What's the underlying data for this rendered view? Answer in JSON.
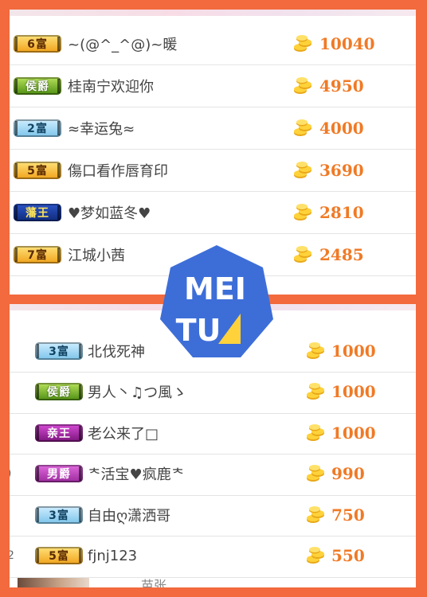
{
  "top_rows": [
    {
      "badge": "6富",
      "badge_style": "gold",
      "name": "~(@^_^@)~暖",
      "score": "10040"
    },
    {
      "badge": "侯爵",
      "badge_style": "green",
      "name": "桂南宁欢迎你",
      "score": "4950"
    },
    {
      "badge": "2富",
      "badge_style": "blue",
      "name": "≈幸运兔≈",
      "score": "4000"
    },
    {
      "badge": "5富",
      "badge_style": "gold",
      "name": "傷口看作唇育印",
      "score": "3690"
    },
    {
      "badge": "藩王",
      "badge_style": "navy",
      "name": "♥梦如蓝冬♥",
      "score": "2810"
    },
    {
      "badge": "7富",
      "badge_style": "gold",
      "name": "江城小茜",
      "score": "2485"
    }
  ],
  "bottom_rows": [
    {
      "badge": "3富",
      "badge_style": "blue",
      "name": "北伐死神",
      "score": "1000",
      "rank_fragment": ""
    },
    {
      "badge": "侯爵",
      "badge_style": "green",
      "name": "男人丶♫つ風ゝ",
      "score": "1000",
      "rank_fragment": ""
    },
    {
      "badge": "亲王",
      "badge_style": "purple",
      "name": "老公来了□",
      "score": "1000",
      "rank_fragment": ""
    },
    {
      "badge": "男爵",
      "badge_style": "magenta",
      "name": "ᅕ活宝♥疯鹿ᅕ",
      "score": "990",
      "rank_fragment": ")"
    },
    {
      "badge": "3富",
      "badge_style": "blue",
      "name": "自由ღ潇洒哥",
      "score": "750",
      "rank_fragment": ""
    },
    {
      "badge": "5富",
      "badge_style": "gold",
      "name": "fjnj123",
      "score": "550",
      "rank_fragment": "2"
    }
  ],
  "bottom_partial": {
    "name": "苗张"
  },
  "watermark": {
    "line1": "MEI",
    "line2": "TU"
  },
  "colors": {
    "frame": "#f26a3d",
    "score": "#f07a26",
    "logo_blue": "#3d6ed8",
    "logo_yellow": "#ffd23c"
  },
  "icons": {
    "coin": "gold-coins-icon"
  }
}
